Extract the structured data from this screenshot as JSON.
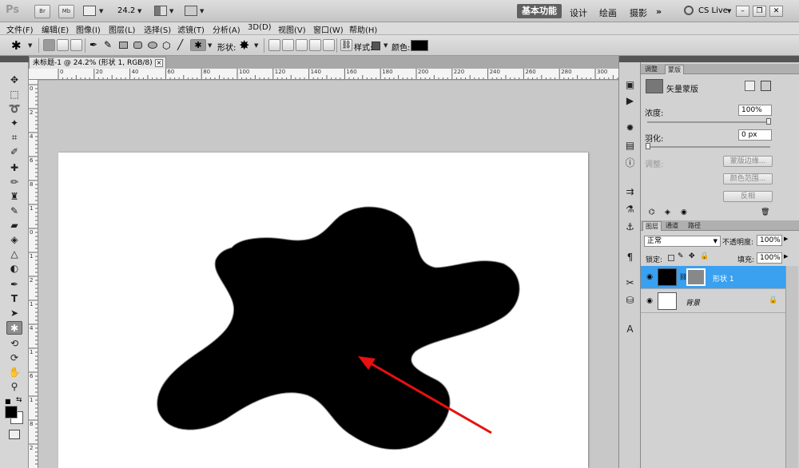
{
  "app": {
    "logo": "Ps",
    "bridge_label": "Br",
    "minibridge_label": "Mb",
    "zoom_value": "24.2",
    "workspaces": {
      "active": "基本功能",
      "items": [
        "设计",
        "绘画",
        "摄影"
      ],
      "more": "»"
    },
    "cs_live": "CS Live",
    "window_buttons": [
      "–",
      "❐",
      "✕"
    ]
  },
  "menu": [
    "文件(F)",
    "编辑(E)",
    "图像(I)",
    "图层(L)",
    "选择(S)",
    "滤镜(T)",
    "分析(A)",
    "3D(D)",
    "视图(V)",
    "窗口(W)",
    "帮助(H)"
  ],
  "options": {
    "shape_label": "形状:",
    "style_label": "样式:",
    "color_label": "颜色:",
    "color_value": "#000000"
  },
  "document": {
    "tab_title": "未标题-1 @ 24.2% (形状 1, RGB/8) *",
    "close": "×",
    "ruler_top": [
      "0",
      "20",
      "40",
      "60",
      "80",
      "100",
      "120",
      "140",
      "160",
      "180",
      "200",
      "220",
      "240",
      "260",
      "280",
      "300"
    ],
    "ruler_left": [
      "0",
      "2",
      "4",
      "6",
      "8",
      "1",
      "0",
      "1",
      "2",
      "1",
      "4",
      "1",
      "6",
      "1",
      "8",
      "2"
    ]
  },
  "masks_panel": {
    "tabs": [
      "调整",
      "蒙版"
    ],
    "title": "矢量蒙版",
    "density_label": "浓度:",
    "density_value": "100%",
    "feather_label": "羽化:",
    "feather_value": "0 px",
    "adjust_label": "调整:",
    "buttons": [
      "蒙版边缘...",
      "颜色范围...",
      "反相"
    ]
  },
  "layers_panel": {
    "tabs": [
      "图层",
      "通道",
      "路径"
    ],
    "blend_mode": "正常",
    "opacity_label": "不透明度:",
    "opacity_value": "100%",
    "lock_label": "锁定:",
    "fill_label": "填充:",
    "fill_value": "100%",
    "layers": [
      {
        "name": "形状 1",
        "selected": true
      },
      {
        "name": "背景",
        "selected": false
      }
    ]
  },
  "colors": {
    "accent": "#3aa0f0",
    "annotation_arrow": "#e81010",
    "shape_fill": "#000000"
  }
}
